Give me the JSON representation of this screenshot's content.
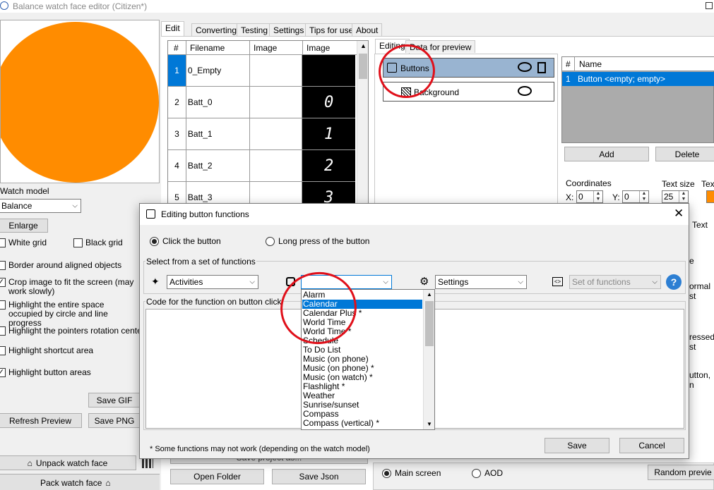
{
  "window": {
    "title": "Balance watch face editor (Citizen*)"
  },
  "left": {
    "watch_model_label": "Watch model",
    "watch_model_value": "Balance",
    "enlarge": "Enlarge",
    "white_grid": "White grid",
    "black_grid": "Black grid",
    "border_aligned": "Border around aligned objects",
    "crop_image": "Crop image to fit the screen (may work slowly)",
    "highlight_space": "Highlight the entire space occupied by circle and line progress",
    "highlight_pointers": "Highlight the pointers rotation center",
    "highlight_shortcut": "Highlight shortcut area",
    "highlight_buttons": "Highlight button areas",
    "save_gif": "Save GIF",
    "refresh_preview": "Refresh Preview",
    "save_png": "Save PNG",
    "unpack": "Unpack watch face",
    "pack": "Pack watch face",
    "colors": {
      "watch": "#ff8c00"
    }
  },
  "tabs": [
    "Edit",
    "Converting",
    "Testing",
    "Settings",
    "Tips for use",
    "About"
  ],
  "grid": {
    "headers": [
      "#",
      "Filename",
      "Image",
      "Image"
    ],
    "rows": [
      {
        "n": "1",
        "file": "0_Empty",
        "glyph": ""
      },
      {
        "n": "2",
        "file": "Batt_0",
        "glyph": "0"
      },
      {
        "n": "3",
        "file": "Batt_1",
        "glyph": "1"
      },
      {
        "n": "4",
        "file": "Batt_2",
        "glyph": "2"
      },
      {
        "n": "5",
        "file": "Batt_3",
        "glyph": "3"
      }
    ]
  },
  "subtabs": [
    "Editing",
    "Data for preview"
  ],
  "layers": {
    "buttons": "Buttons",
    "background": "Background"
  },
  "props": {
    "col_hash": "#",
    "col_name": "Name",
    "row_n": "1",
    "row_name": "Button <empty; empty>",
    "add": "Add",
    "delete": "Delete",
    "coordinates": "Coordinates",
    "x_label": "X:",
    "x_value": "0",
    "y_label": "Y:",
    "y_value": "0",
    "text_size_label": "Text size",
    "text_size_value": "25",
    "tex_cut": "Tex",
    "text_cut": "Text",
    "e_cut": "e",
    "normal_cut": "ormal st",
    "pressed_cut": "ressed st",
    "button_cut": "utton,",
    "n_cut": "n"
  },
  "bottom": {
    "open_folder": "Open Folder",
    "save_json": "Save Json",
    "save_project": "Save project as...",
    "main_screen": "Main screen",
    "aod": "AOD",
    "random_preview": "Random previe"
  },
  "dialog": {
    "title": "Editing button functions",
    "click": "Click the button",
    "long_press": "Long press of the button",
    "select_group": "Select from a set of functions",
    "activities": "Activities",
    "settings": "Settings",
    "set_of_functions": "Set of functions",
    "code_label": "Code for the function on button click",
    "footnote": "* Some functions may not work (depending on the watch model)",
    "save": "Save",
    "cancel": "Cancel",
    "help": "?",
    "list": [
      "Alarm",
      "Calendar",
      "Calendar Plus *",
      "World Time",
      "World Time *",
      "Schedule",
      "To Do List",
      "Music (on phone)",
      "Music (on phone) *",
      "Music (on watch) *",
      "Flashlight *",
      "Weather",
      "Sunrise/sunset",
      "Compass",
      "Compass (vertical) *"
    ],
    "colors": {
      "selection": "#0078d7"
    }
  }
}
